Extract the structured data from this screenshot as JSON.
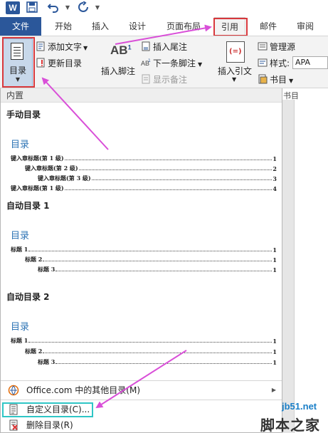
{
  "app": {
    "logo_letter": "W",
    "accent": "#2b579a"
  },
  "quick_access": {
    "save_icon": "save-icon",
    "undo_icon": "undo-icon",
    "redo_icon": "redo-icon"
  },
  "tabs": [
    {
      "label": "文件"
    },
    {
      "label": "开始"
    },
    {
      "label": "插入"
    },
    {
      "label": "设计"
    },
    {
      "label": "页面布局"
    },
    {
      "label": "引用"
    },
    {
      "label": "邮件"
    },
    {
      "label": "审阅"
    }
  ],
  "ribbon": {
    "toc_label": "目录",
    "add_text": "添加文字",
    "update_toc": "更新目录",
    "insert_footnote": "插入脚注",
    "insert_endnote": "插入尾注",
    "next_footnote": "下一条脚注",
    "show_notes": "显示备注",
    "insert_citation": "插入引文",
    "manage_sources": "管理源",
    "style_label": "样式:",
    "style_value": "APA",
    "bibliography": "书目",
    "group_caption": "书目"
  },
  "gallery": {
    "header": "内置",
    "manual": {
      "title": "手动目录",
      "heading": "目录",
      "lines": [
        {
          "text": "键入章标题(第 1 级)",
          "page": "1"
        },
        {
          "text": "键入章标题(第 2 级)",
          "page": "2"
        },
        {
          "text": "键入章标题(第 3 级)",
          "page": "3"
        },
        {
          "text": "键入章标题(第 1 级)",
          "page": "4"
        }
      ]
    },
    "auto1": {
      "title": "自动目录 1",
      "heading": "目录",
      "lines": [
        {
          "text": "标题 1",
          "page": "1"
        },
        {
          "text": "标题 2",
          "page": "1"
        },
        {
          "text": "标题 3",
          "page": "1"
        }
      ]
    },
    "auto2": {
      "title": "自动目录 2",
      "heading": "目录",
      "lines": [
        {
          "text": "标题 1",
          "page": "1"
        },
        {
          "text": "标题 2",
          "page": "1"
        },
        {
          "text": "标题 3",
          "page": "1"
        }
      ]
    }
  },
  "menu": {
    "more_toc": "Office.com 中的其他目录(M)",
    "custom_toc": "自定义目录(C)...",
    "remove_toc": "删除目录(R)"
  },
  "watermark": {
    "url": "jb51.net",
    "site": "脚本之家"
  },
  "colors": {
    "annotation_arrow": "#d94fd8",
    "highlight_cyan": "#2fc6c6",
    "highlight_red": "#d8383c",
    "toc_heading": "#2e74b5"
  }
}
